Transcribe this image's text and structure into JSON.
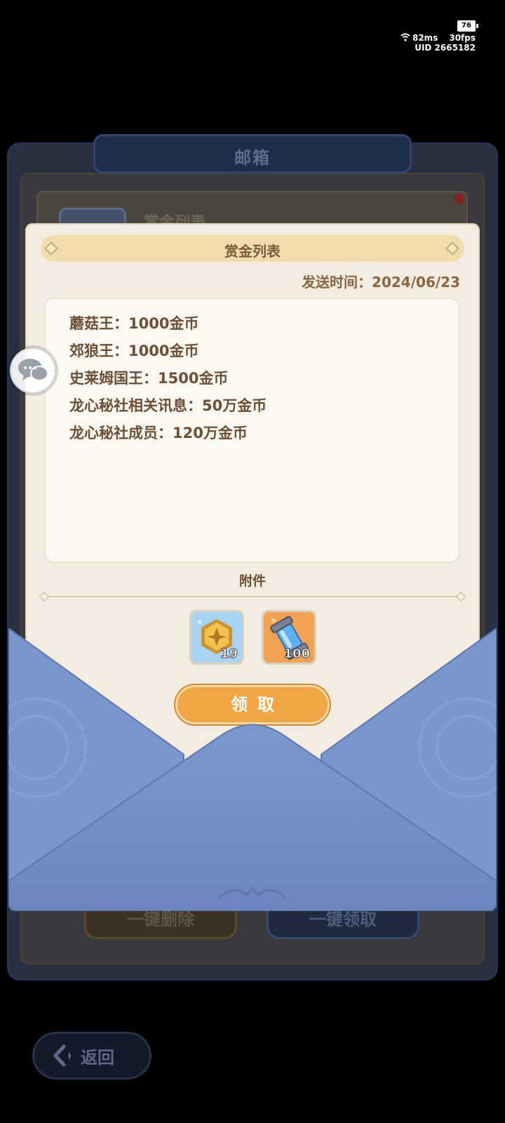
{
  "status": {
    "battery": "76",
    "ping": "82ms",
    "fps": "30fps",
    "uid": "UID 2665182"
  },
  "mailbox": {
    "title": "邮箱",
    "list_item_title": "赏金列表",
    "delete_all_label": "一键删除",
    "claim_all_label": "一键领取"
  },
  "back": {
    "label": "返回"
  },
  "mail": {
    "title": "赏金列表",
    "send_time": "发送时间：2024/06/23",
    "lines": [
      "蘑菇王：1000金币",
      "郊狼王：1000金币",
      "史莱姆国王：1500金币",
      "龙心秘社相关讯息：50万金币",
      "龙心秘社成员：120万金币"
    ],
    "attachments_label": "附件",
    "attachments": [
      {
        "icon": "gold-medal-icon",
        "count": "19"
      },
      {
        "icon": "crystal-capsule-icon",
        "count": "100"
      }
    ],
    "claim_label": "领取"
  },
  "colors": {
    "envelope": "#7796cb",
    "claim_button": "#f0a645",
    "letter_bg": "#f3ece0",
    "text_brown": "#6e4e34"
  }
}
